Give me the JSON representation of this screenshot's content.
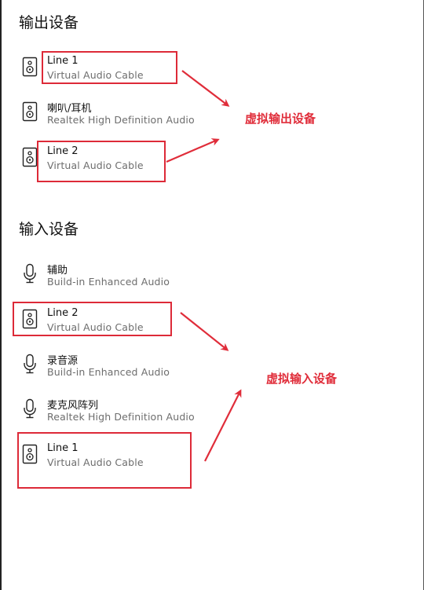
{
  "output_section": {
    "title": "输出设备",
    "devices": [
      {
        "name": "Line 1",
        "description": "Virtual Audio Cable",
        "icon": "speaker-icon"
      },
      {
        "name": "喇叭/耳机",
        "description": "Realtek High Definition Audio",
        "icon": "speaker-icon"
      },
      {
        "name": "Line 2",
        "description": "Virtual Audio Cable",
        "icon": "speaker-icon"
      }
    ]
  },
  "input_section": {
    "title": "输入设备",
    "devices": [
      {
        "name": "辅助",
        "description": "Build-in Enhanced Audio",
        "icon": "microphone-icon"
      },
      {
        "name": "Line 2",
        "description": "Virtual Audio Cable",
        "icon": "speaker-icon"
      },
      {
        "name": "录音源",
        "description": "Build-in Enhanced Audio",
        "icon": "microphone-icon"
      },
      {
        "name": "麦克风阵列",
        "description": "Realtek High Definition Audio",
        "icon": "microphone-icon"
      },
      {
        "name": "Line 1",
        "description": "Virtual Audio Cable",
        "icon": "speaker-icon"
      }
    ]
  },
  "annotations": {
    "virtual_output": "虚拟输出设备",
    "virtual_input": "虚拟输入设备"
  },
  "colors": {
    "annotation_red": "#e02d3a",
    "text_primary": "#111111",
    "text_secondary": "#6d6d6d"
  }
}
